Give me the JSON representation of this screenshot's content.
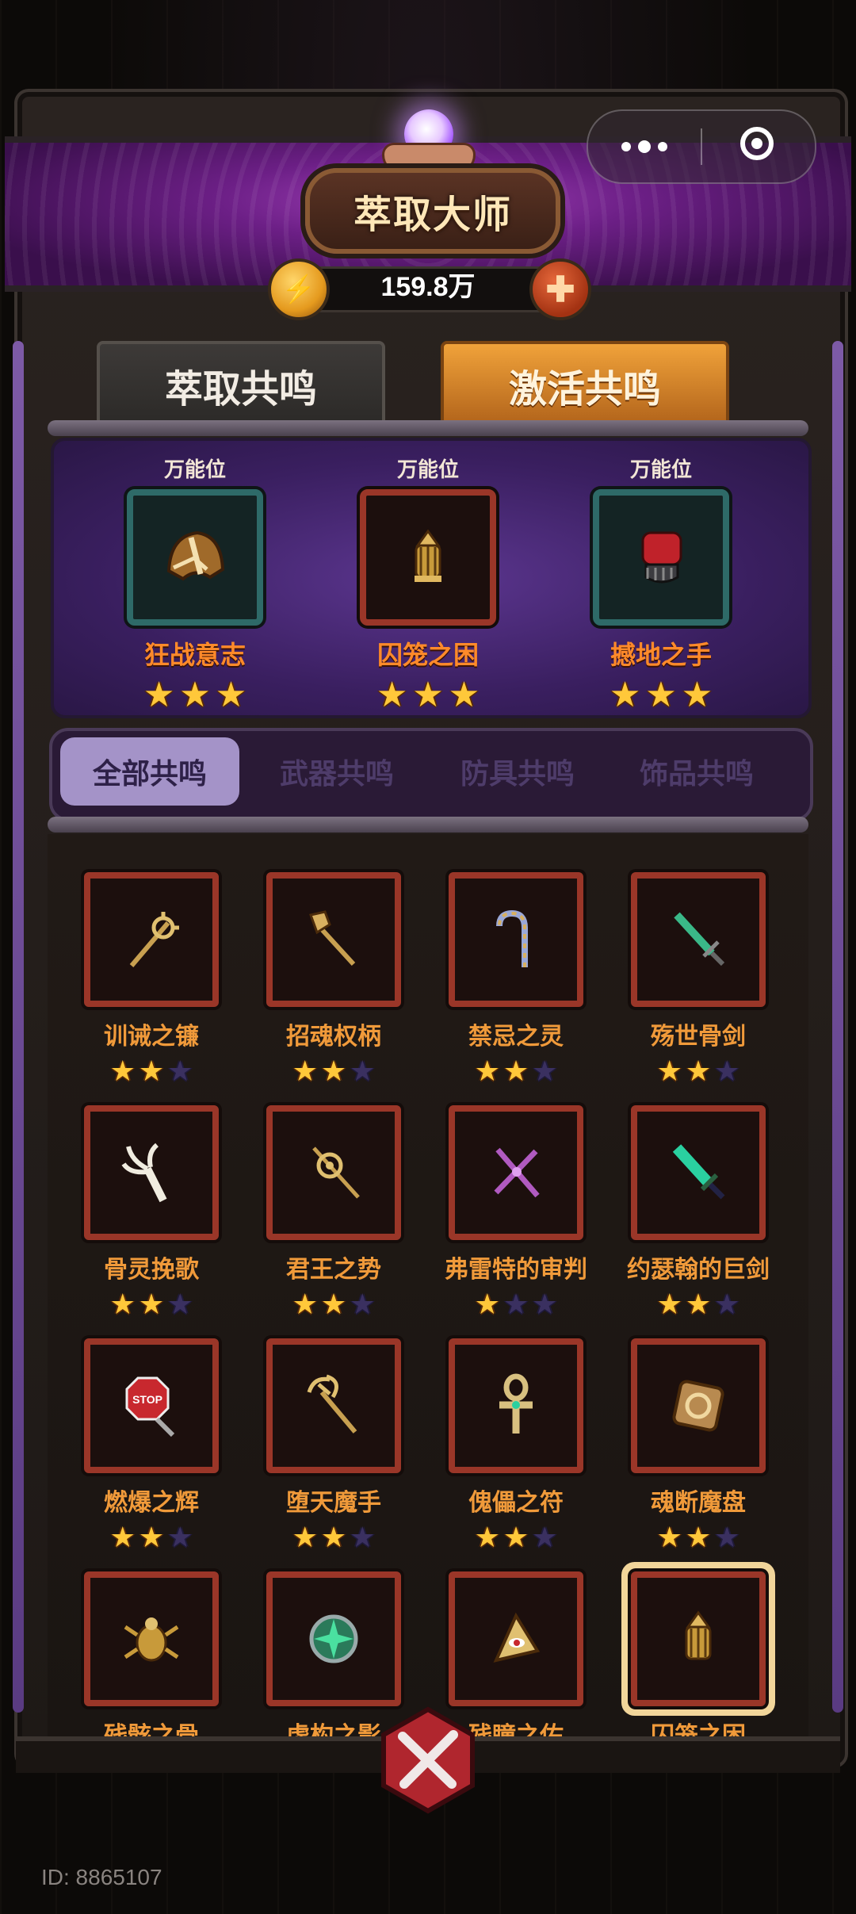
{
  "header": {
    "title": "萃取大师",
    "currency_value": "159.8万"
  },
  "tabs": [
    {
      "label": "萃取共鸣"
    },
    {
      "label": "激活共鸣"
    }
  ],
  "featured": [
    {
      "caption": "万能位",
      "name": "狂战意志",
      "stars": 3,
      "frame": "teal",
      "icon": "helmet-icon"
    },
    {
      "caption": "万能位",
      "name": "囚笼之困",
      "stars": 3,
      "frame": "red",
      "icon": "lantern-icon"
    },
    {
      "caption": "万能位",
      "name": "撼地之手",
      "stars": 3,
      "frame": "teal",
      "icon": "gauntlet-icon"
    }
  ],
  "filters": [
    {
      "label": "全部共鸣",
      "active": true
    },
    {
      "label": "武器共鸣"
    },
    {
      "label": "防具共鸣"
    },
    {
      "label": "饰品共鸣"
    }
  ],
  "items": [
    {
      "name": "训诫之镰",
      "stars": 2,
      "icon": "scythe-icon"
    },
    {
      "name": "招魂权柄",
      "stars": 2,
      "icon": "hand-scepter-icon"
    },
    {
      "name": "禁忌之灵",
      "stars": 2,
      "icon": "cane-icon"
    },
    {
      "name": "殇世骨剑",
      "stars": 2,
      "icon": "green-sword-icon"
    },
    {
      "name": "骨灵挽歌",
      "stars": 2,
      "icon": "bone-claw-icon"
    },
    {
      "name": "君王之势",
      "stars": 2,
      "icon": "crown-spear-icon"
    },
    {
      "name": "弗雷特的审判",
      "stars": 1,
      "icon": "cross-spear-icon"
    },
    {
      "name": "约瑟翰的巨剑",
      "stars": 2,
      "icon": "jade-greatsword-icon"
    },
    {
      "name": "燃爆之辉",
      "stars": 2,
      "icon": "stop-sign-icon"
    },
    {
      "name": "堕天魔手",
      "stars": 2,
      "icon": "trident-icon"
    },
    {
      "name": "傀儡之符",
      "stars": 2,
      "icon": "ankh-icon"
    },
    {
      "name": "魂断魔盘",
      "stars": 2,
      "icon": "disc-icon"
    },
    {
      "name": "残骸之骨",
      "stars": 0,
      "icon": "scarab-icon"
    },
    {
      "name": "虚构之影",
      "stars": 0,
      "icon": "green-orb-icon"
    },
    {
      "name": "残瞳之佑",
      "stars": 0,
      "icon": "eye-pyramid-icon"
    },
    {
      "name": "囚笼之困",
      "stars": 0,
      "icon": "lantern-icon",
      "selected": true
    }
  ],
  "footer": {
    "id_text": "ID: 8865107"
  }
}
